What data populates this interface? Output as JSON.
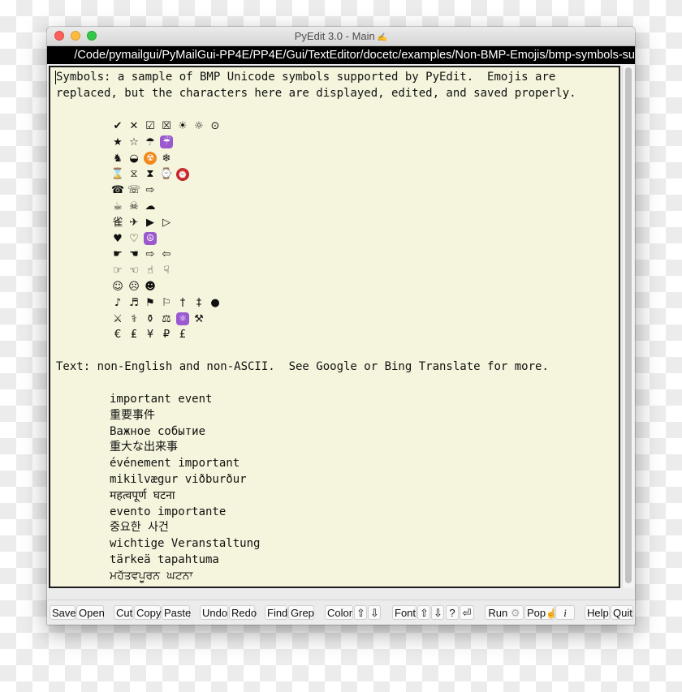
{
  "window": {
    "title": "PyEdit 3.0 - Main",
    "title_icon": "pencil-icon",
    "path": "/Code/pymailgui/PyMailGui-PP4E/PP4E/Gui/TextEditor/docetc/examples/Non-BMP-Emojis/bmp-symbols-su"
  },
  "editor": {
    "intro_line1": "Symbols: a sample of BMP Unicode symbols supported by PyEdit.  Emojis are",
    "intro_line2": "replaced, but the characters here are displayed, edited, and saved properly.",
    "symbol_rows": [
      [
        "✔",
        "✕",
        "☑",
        "☒",
        "☀",
        "☼",
        "⊙"
      ],
      [
        "★",
        "☆",
        "☂",
        "☔"
      ],
      [
        "♞",
        "◒",
        "☢",
        "❄"
      ],
      [
        "⌛",
        "⧖",
        "⧗",
        "⌚",
        "⏰"
      ],
      [
        "☎",
        "☏",
        "⇨"
      ],
      [
        "☕",
        "☠",
        "☁"
      ],
      [
        "雀",
        "✈",
        "▶",
        "▷"
      ],
      [
        "♥",
        "♡",
        "☮"
      ],
      [
        "☛",
        "☚",
        "⇨",
        "⇦"
      ],
      [
        "☞",
        "☜",
        "☝",
        "☟"
      ],
      [
        "☺",
        "☹",
        "☻"
      ],
      [
        "♪",
        "♬",
        "⚑",
        "⚐",
        "†",
        "‡",
        "●"
      ],
      [
        "⚔",
        "⚕",
        "⚱",
        "⚖",
        "⚛",
        "⚒"
      ],
      [
        "€",
        "₤",
        "¥",
        "₽",
        "£"
      ]
    ],
    "text_heading": "Text: non-English and non-ASCII.  See Google or Bing Translate for more.",
    "phrases": [
      "important event",
      "重要事件",
      "Важное событие",
      "重大な出来事",
      "événement important",
      "mikilvægur viðburður",
      "महत्वपूर्ण घटना",
      "evento importante",
      "중요한 사건",
      "wichtige Veranstaltung",
      "tärkeä tapahtuma",
      "ਮਹੱਤਵਪੂਰਨ ਘਟਨਾ"
    ]
  },
  "toolbar": {
    "save": "Save",
    "open": "Open",
    "cut": "Cut",
    "copy": "Copy",
    "paste": "Paste",
    "undo": "Undo",
    "redo": "Redo",
    "find": "Find",
    "grep": "Grep",
    "color": "Color",
    "color_up": "⇧",
    "color_down": "⇩",
    "font": "Font",
    "font_up": "⇧",
    "font_down": "⇩",
    "font_help": "?",
    "font_enter": "⏎",
    "run": "Run",
    "run_icon": "⚙",
    "pop": "Pop",
    "pop_icon": "☝",
    "info": "i",
    "help": "Help",
    "quit": "Quit"
  },
  "colors": {
    "editor_bg": "#f5f4dc",
    "path_bg": "#000000",
    "emoji_orange": "#f08a1c",
    "emoji_purple": "#9b59d0",
    "emoji_red": "#c0282d"
  }
}
